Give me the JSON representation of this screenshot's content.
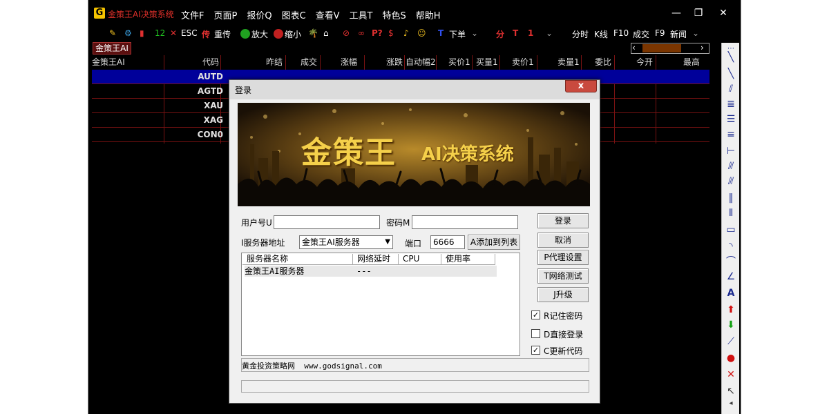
{
  "app": {
    "logo": "G",
    "title": "金策王AI决策系统",
    "menu": [
      "文件F",
      "页面P",
      "报价Q",
      "图表C",
      "查看V",
      "工具T",
      "特色S",
      "帮助H"
    ],
    "window_controls": [
      "—",
      "❐",
      "✕"
    ]
  },
  "toolbar": {
    "num_12": "12",
    "esc": "ESC",
    "chuan": "传",
    "chong_chuan": "重传",
    "zoom_in": "放大",
    "zoom_out": "缩小",
    "p_q": "P?",
    "xiadan": "下单",
    "fen": "分",
    "t": "T",
    "one": "1",
    "fenshi": "分时",
    "kxian": "K线",
    "f10": "F10",
    "chengjiao": "成交",
    "f9": "F9",
    "news": "新闻"
  },
  "tab": {
    "label": "金策王AI"
  },
  "grid": {
    "headers": [
      "金策王AI",
      "代码",
      "昨结",
      "成交",
      "涨幅",
      "涨跌",
      "自动幅2",
      "买价1",
      "买量1",
      "卖价1",
      "卖量1",
      "委比",
      "今开",
      "最高"
    ],
    "codes": [
      "AUTD",
      "AGTD",
      "XAU",
      "XAG",
      "CON0"
    ]
  },
  "dialog": {
    "title": "登录",
    "close": "x",
    "banner_title": "金策王",
    "banner_sub": "AI决策系统",
    "user_label": "用户号U",
    "user_value": "",
    "pwd_label": "密码M",
    "pwd_value": "",
    "server_addr_label": "I服务器地址",
    "server_select": "金策王AI服务器",
    "port_label": "端口",
    "port_value": "6666",
    "add_to_list": "A添加到列表",
    "list_headers": [
      "服务器名称",
      "网络延时",
      "CPU",
      "使用率"
    ],
    "list_rows": [
      {
        "name": "金策王AI服务器",
        "latency": "---"
      }
    ],
    "buttons": {
      "login": "登录",
      "cancel": "取消",
      "proxy": "P代理设置",
      "nettest": "T网络测试",
      "upgrade": "J升级"
    },
    "checks": [
      {
        "label": "R记住密码",
        "checked": true
      },
      {
        "label": "D直接登录",
        "checked": false
      },
      {
        "label": "C更新代码",
        "checked": true
      }
    ],
    "footer": "黄金投资策略网  www.godsignal.com"
  }
}
